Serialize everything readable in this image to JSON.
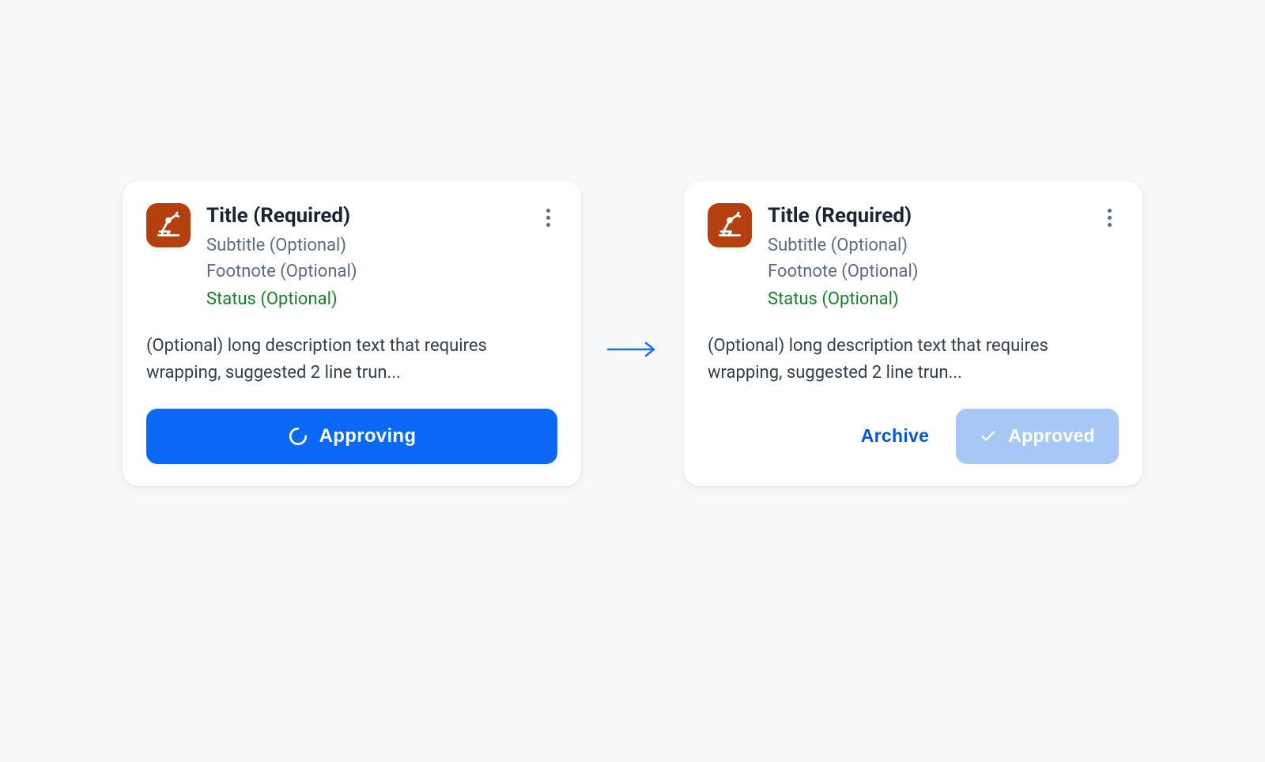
{
  "card1": {
    "title": "Title (Required)",
    "subtitle": "Subtitle (Optional)",
    "footnote": "Footnote (Optional)",
    "status": "Status (Optional)",
    "description": "(Optional) long description text that requires wrapping, suggested 2 line trun...",
    "button_label": "Approving"
  },
  "card2": {
    "title": "Title (Required)",
    "subtitle": "Subtitle (Optional)",
    "footnote": "Footnote (Optional)",
    "status": "Status (Optional)",
    "description": "(Optional) long description text that requires wrapping, suggested 2 line trun...",
    "archive_label": "Archive",
    "approved_label": "Approved"
  }
}
